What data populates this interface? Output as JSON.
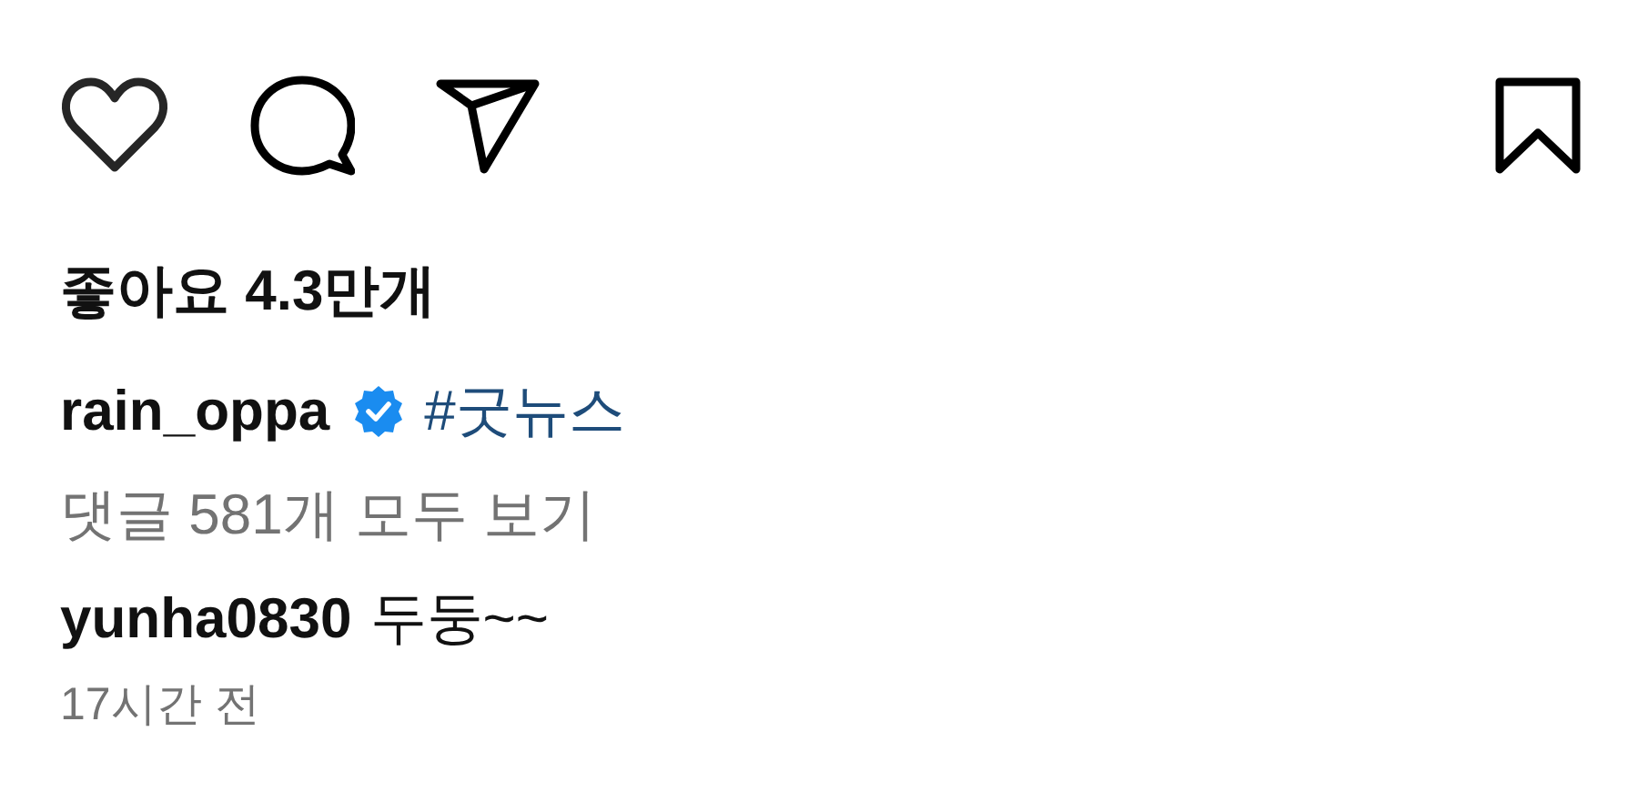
{
  "likes": "좋아요 4.3만개",
  "caption": {
    "username": "rain_oppa",
    "verified": true,
    "text": "#굿뉴스"
  },
  "view_comments": "댓글 581개 모두 보기",
  "comment": {
    "username": "yunha0830",
    "text": "두둥~~"
  },
  "time": "17시간 전"
}
